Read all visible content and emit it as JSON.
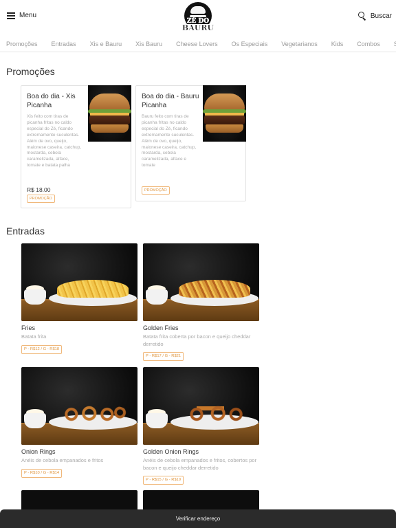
{
  "header": {
    "menu_label": "Menu",
    "search_label": "Buscar",
    "logo_text_top": "ZÉ DO",
    "logo_text_bottom": "BAURU"
  },
  "tabs": [
    "Promoções",
    "Entradas",
    "Xis e Bauru",
    "Xis Bauru",
    "Cheese Lovers",
    "Os Especiais",
    "Vegetarianos",
    "Kids",
    "Combos",
    "Sobremesas"
  ],
  "promocoes": {
    "title": "Promoções",
    "items": [
      {
        "title": "Boa do dia - Xis Picanha",
        "description": "Xis feito com tiras de picanha fritas no caldo especial do Zé, ficando extremamente suculentas. Além de ovo, queijo, maionese caseira, catchup, mostarda, cebola caramelizada, alface, tomate e batata palha",
        "price": "R$ 18.00",
        "badge": "PROMOÇÃO"
      },
      {
        "title": "Boa do dia - Bauru Picanha",
        "description": "Bauru feito com tiras de picanha fritas no caldo especial do Zé, ficando extremamente suculentas. Além de ovo, queijo, maionese caseira, catchup, mostarda, cebola caramelizada, alface e tomate",
        "price": "",
        "badge": "PROMOÇÃO"
      }
    ]
  },
  "entradas": {
    "title": "Entradas",
    "items": [
      {
        "name": "Fries",
        "description": "Batata frita",
        "price": "P - R$12 / G - R$18"
      },
      {
        "name": "Golden Fries",
        "description": "Batata frita coberta por bacon e queijo cheddar derretido",
        "price": "P - R$17 / G - R$21"
      },
      {
        "name": "Onion Rings",
        "description": "Anéis de cebola empanados e fritos",
        "price": "P - R$10 / G - R$14"
      },
      {
        "name": "Golden Onion Rings",
        "description": "Anéis de cebola empanados e fritos, cobertos por bacon e queijo cheddar derretido",
        "price": "P - R$15 / G - R$19"
      }
    ]
  },
  "bottom_bar": {
    "label": "Verificar endereço"
  }
}
